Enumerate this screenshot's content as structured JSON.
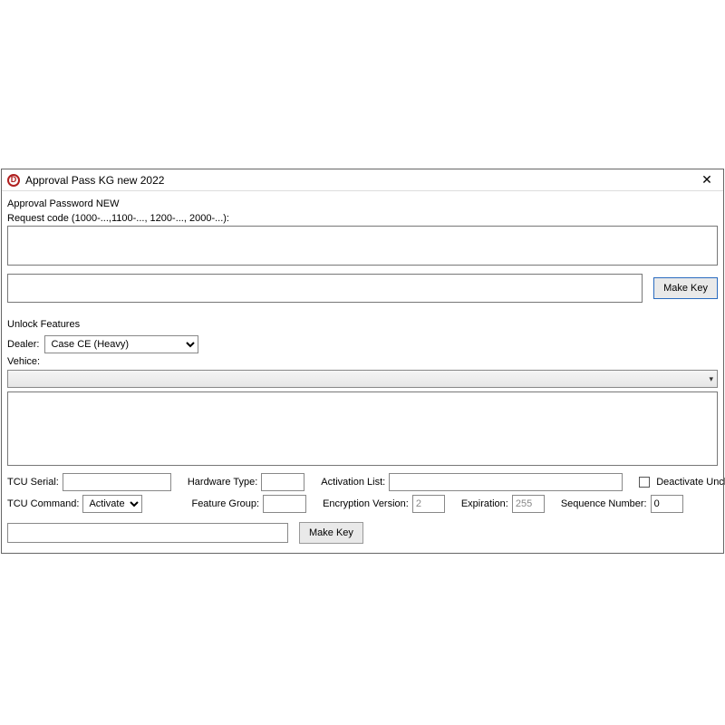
{
  "window": {
    "title": "Approval Pass KG new 2022",
    "icon_letter": "D"
  },
  "approval": {
    "section_label": "Approval Password NEW",
    "request_label": "Request code (1000-...,1100-..., 1200-..., 2000-...):",
    "make_key_label": "Make Key"
  },
  "unlock": {
    "section_label": "Unlock Features",
    "dealer_label": "Dealer:",
    "dealer_value": "Case CE (Heavy)",
    "vehicle_label": "Vehice:",
    "tcu_serial_label": "TCU Serial:",
    "tcu_serial_value": "",
    "hardware_type_label": "Hardware Type:",
    "hardware_type_value": "",
    "activation_list_label": "Activation List:",
    "activation_list_value": "",
    "deactivate_label": "Deactivate Unchecked",
    "tcu_command_label": "TCU Command:",
    "tcu_command_value": "Activate",
    "feature_group_label": "Feature Group:",
    "feature_group_value": "",
    "encryption_version_label": "Encryption Version:",
    "encryption_version_value": "2",
    "expiration_label": "Expiration:",
    "expiration_value": "255",
    "sequence_number_label": "Sequence Number:",
    "sequence_number_value": "0",
    "make_key_label": "Make Key"
  }
}
